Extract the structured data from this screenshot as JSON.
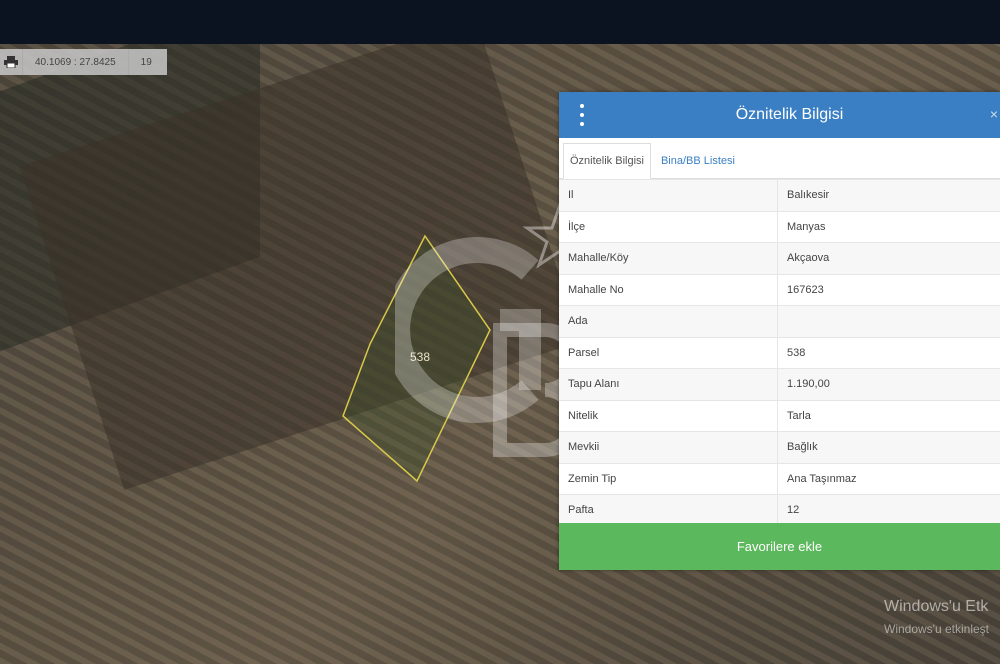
{
  "map": {
    "coordinates": "40.1069 : 27.8425",
    "zoom": "19",
    "parcel_label": "538",
    "print_icon": "printer-icon"
  },
  "panel": {
    "title": "Öznitelik Bilgisi",
    "menu_icon": "vertical-dots-icon",
    "tabs": [
      {
        "label": "Öznitelik Bilgisi",
        "active": true
      },
      {
        "label": "Bina/BB Listesi",
        "active": false
      }
    ],
    "rows": [
      {
        "key": "Il",
        "value": "Balıkesir"
      },
      {
        "key": "İlçe",
        "value": "Manyas"
      },
      {
        "key": "Mahalle/Köy",
        "value": "Akçaova"
      },
      {
        "key": "Mahalle No",
        "value": "167623"
      },
      {
        "key": "Ada",
        "value": ""
      },
      {
        "key": "Parsel",
        "value": "538"
      },
      {
        "key": "Tapu Alanı",
        "value": "1.190,00"
      },
      {
        "key": "Nitelik",
        "value": "Tarla"
      },
      {
        "key": "Mevkii",
        "value": "Bağlık"
      },
      {
        "key": "Zemin Tip",
        "value": "Ana Taşınmaz"
      },
      {
        "key": "Pafta",
        "value": "12"
      }
    ],
    "favorite_button": "Favorilere ekle"
  },
  "windows_notice": {
    "line1": "Windows'u Etk",
    "line2": "Windows'u etkinleşt"
  },
  "colors": {
    "header": "#3a7fc4",
    "button": "#5cb85c",
    "parcel_outline": "#d8c84a"
  }
}
